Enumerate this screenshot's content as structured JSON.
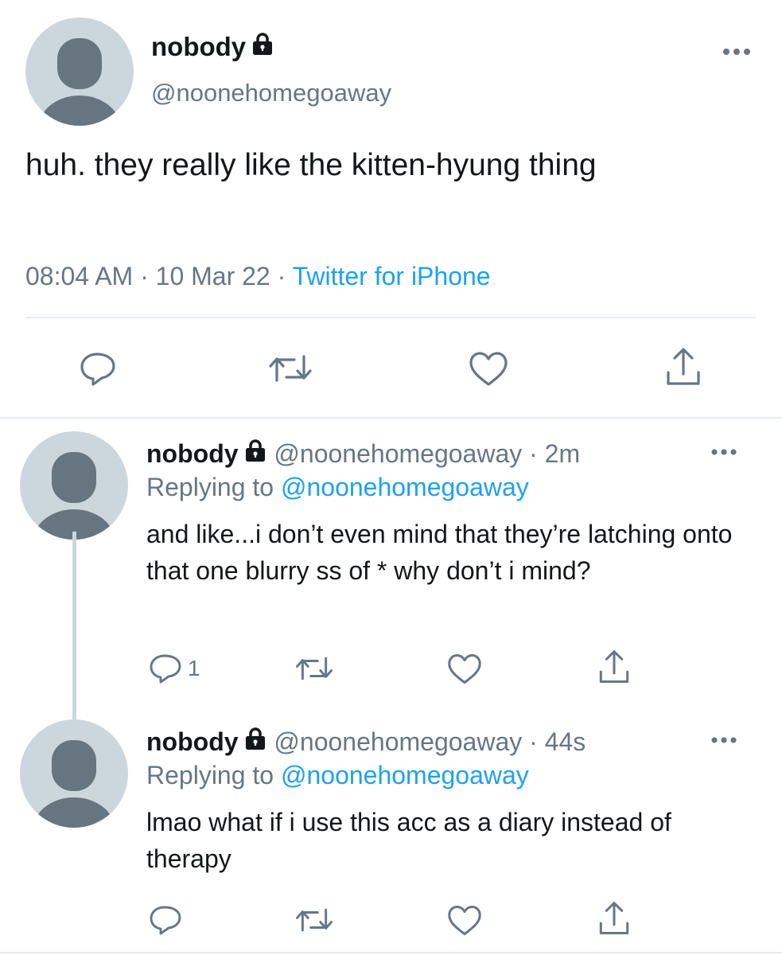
{
  "main_tweet": {
    "display_name": "nobody",
    "handle": "@noonehomegoaway",
    "text": "huh. they really like the kitten-hyung thing",
    "time": "08:04 AM",
    "date": "10 Mar 22",
    "separator": "·",
    "source": "Twitter for iPhone",
    "icons": [
      "lock-icon",
      "more-icon",
      "reply-icon",
      "retweet-icon",
      "like-icon",
      "share-icon"
    ]
  },
  "replies": [
    {
      "display_name": "nobody",
      "handle": "@noonehomegoaway",
      "dot": "·",
      "age": "2m",
      "replying_label": "Replying to",
      "replying_to": "@noonehomegoaway",
      "text": "and like...i don’t even mind that they’re latching onto that one blurry ss of * why don’t i mind?",
      "reply_count": "1"
    },
    {
      "display_name": "nobody",
      "handle": "@noonehomegoaway",
      "dot": "·",
      "age": "44s",
      "replying_label": "Replying to",
      "replying_to": "@noonehomegoaway",
      "text": "lmao what if i use this acc as a diary instead of therapy",
      "reply_count": ""
    }
  ],
  "colors": {
    "text": "#14171a",
    "secondary": "#657786",
    "accent": "#1da1f2",
    "avatar_bg": "#ccd6dd",
    "avatar_fg": "#66757f",
    "divider": "#e6ecf0"
  }
}
